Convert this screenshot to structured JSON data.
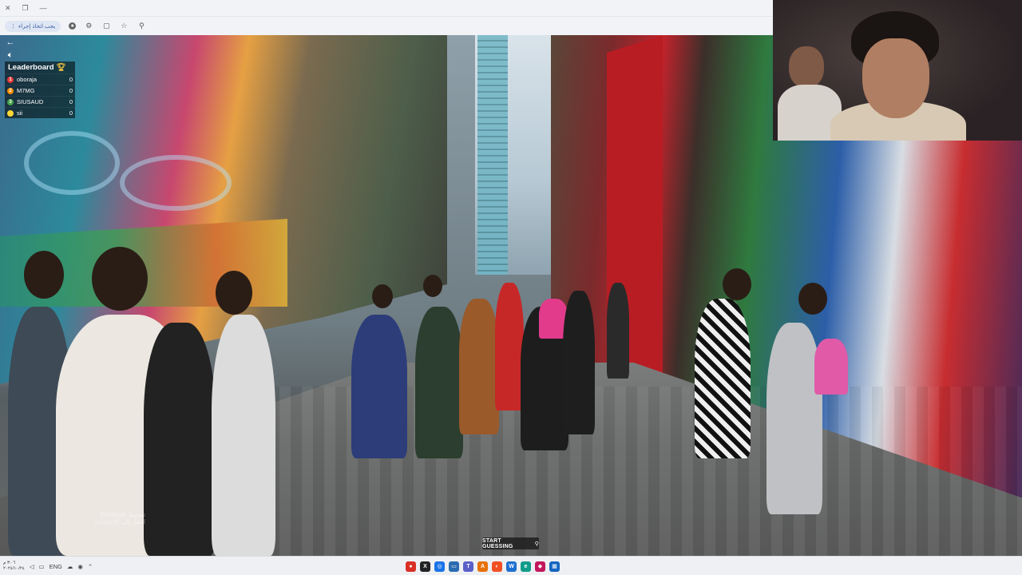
{
  "browser": {
    "extension_pill": "يجب اتخاذ إجراء",
    "titlebar_icons": [
      "close-icon",
      "restore-icon",
      "minimize-icon"
    ],
    "toolbar_icons": [
      "opera-icon",
      "extensions-icon",
      "window-icon",
      "star-icon",
      "pin-icon"
    ]
  },
  "leaderboard": {
    "title": "Leaderboard",
    "players": [
      {
        "rank": "1",
        "name": "oboraja",
        "score": "0",
        "color": "#e53935"
      },
      {
        "rank": "2",
        "name": "M7MG",
        "score": "0",
        "color": "#fb8c00"
      },
      {
        "rank": "3",
        "name": "SIUSAUD",
        "score": "0",
        "color": "#43a047"
      },
      {
        "rank": "",
        "name": "sii",
        "score": "0",
        "color": "#fdd835"
      }
    ]
  },
  "overlay": {
    "back_icon": "back-arrow-icon",
    "sound_icon": "speaker-icon"
  },
  "start_button": {
    "label": "START GUESSING"
  },
  "watermark": {
    "line1": "Windows تنشيط",
    "line2": "انتقل إلى الإعدادات"
  },
  "taskbar": {
    "time": "٣:٠٦ م",
    "date": "٢٠٢٤/١٠/٢٤",
    "language": "ENG",
    "apps": [
      {
        "name": "app-red",
        "color": "#d93025",
        "glyph": "●"
      },
      {
        "name": "app-black",
        "color": "#222222",
        "glyph": "X"
      },
      {
        "name": "chrome",
        "color": "#1a73e8",
        "glyph": "◎"
      },
      {
        "name": "explorer",
        "color": "#2b6cb0",
        "glyph": "▭"
      },
      {
        "name": "teams",
        "color": "#5b5fc7",
        "glyph": "T"
      },
      {
        "name": "acrobat",
        "color": "#e8710a",
        "glyph": "A"
      },
      {
        "name": "firefox",
        "color": "#f25022",
        "glyph": "◐"
      },
      {
        "name": "word",
        "color": "#1e6fd0",
        "glyph": "W"
      },
      {
        "name": "edge",
        "color": "#0f9d8a",
        "glyph": "e"
      },
      {
        "name": "photos",
        "color": "#c2185b",
        "glyph": "◆"
      },
      {
        "name": "store",
        "color": "#1565c0",
        "glyph": "▦"
      }
    ]
  }
}
